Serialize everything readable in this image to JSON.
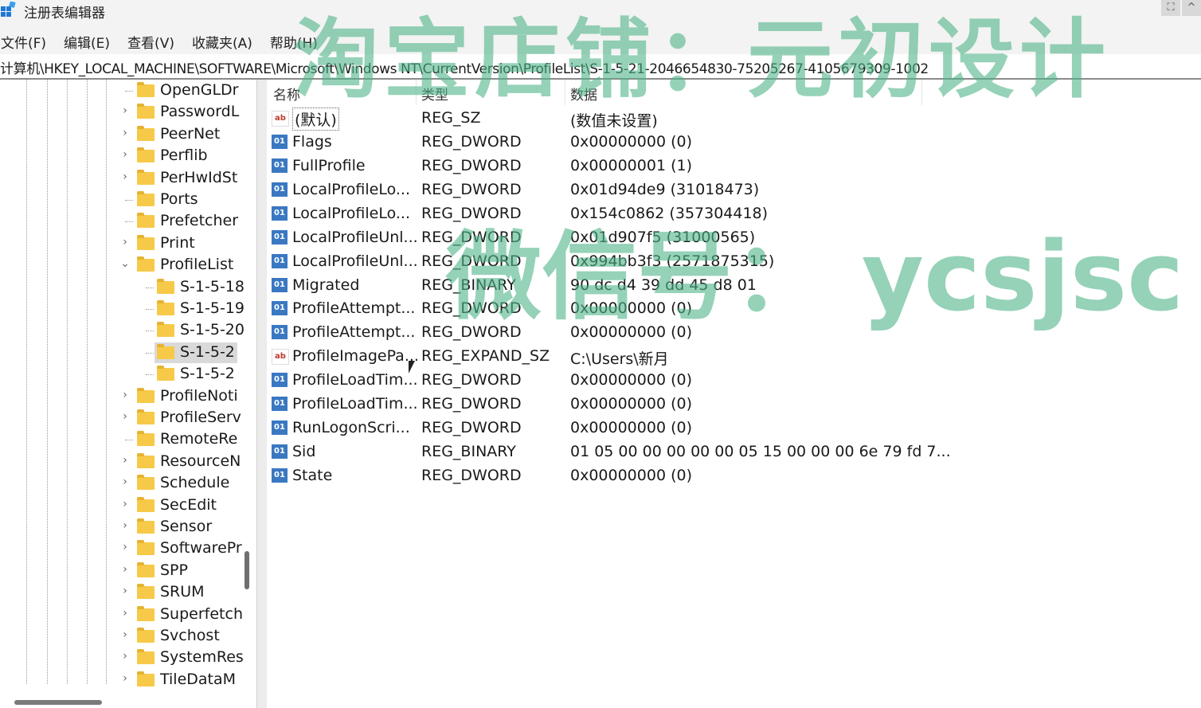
{
  "window": {
    "title": "注册表编辑器"
  },
  "menu": [
    "文件(F)",
    "编辑(E)",
    "查看(V)",
    "收藏夹(A)",
    "帮助(H)"
  ],
  "address": "计算机\\HKEY_LOCAL_MACHINE\\SOFTWARE\\Microsoft\\Windows NT\\CurrentVersion\\ProfileList\\S-1-5-21-2046654830-75205267-4105679309-1002",
  "tree": {
    "items": [
      {
        "label": "OpenGLDr",
        "expander": "none"
      },
      {
        "label": "PasswordL",
        "expander": "collapsed"
      },
      {
        "label": "PeerNet",
        "expander": "collapsed"
      },
      {
        "label": "Perflib",
        "expander": "collapsed"
      },
      {
        "label": "PerHwIdSt",
        "expander": "collapsed"
      },
      {
        "label": "Ports",
        "expander": "none"
      },
      {
        "label": "Prefetcher",
        "expander": "none"
      },
      {
        "label": "Print",
        "expander": "collapsed"
      },
      {
        "label": "ProfileList",
        "expander": "expanded"
      },
      {
        "label": "S-1-5-18",
        "expander": "child"
      },
      {
        "label": "S-1-5-19",
        "expander": "child"
      },
      {
        "label": "S-1-5-20",
        "expander": "child"
      },
      {
        "label": "S-1-5-2",
        "expander": "child",
        "selected": true
      },
      {
        "label": "S-1-5-2",
        "expander": "child"
      },
      {
        "label": "ProfileNoti",
        "expander": "collapsed"
      },
      {
        "label": "ProfileServ",
        "expander": "collapsed"
      },
      {
        "label": "RemoteRe",
        "expander": "none"
      },
      {
        "label": "ResourceN",
        "expander": "collapsed"
      },
      {
        "label": "Schedule",
        "expander": "collapsed"
      },
      {
        "label": "SecEdit",
        "expander": "collapsed"
      },
      {
        "label": "Sensor",
        "expander": "collapsed"
      },
      {
        "label": "SoftwarePr",
        "expander": "collapsed"
      },
      {
        "label": "SPP",
        "expander": "collapsed"
      },
      {
        "label": "SRUM",
        "expander": "collapsed"
      },
      {
        "label": "Superfetch",
        "expander": "collapsed"
      },
      {
        "label": "Svchost",
        "expander": "collapsed"
      },
      {
        "label": "SystemRes",
        "expander": "collapsed"
      },
      {
        "label": "TileDataM",
        "expander": "collapsed"
      }
    ]
  },
  "values": {
    "headers": {
      "name": "名称",
      "type": "类型",
      "data": "数据"
    },
    "rows": [
      {
        "icon": "string-value-icon",
        "name": "(默认)",
        "type": "REG_SZ",
        "data": "(数值未设置)"
      },
      {
        "icon": "binary-value-icon",
        "name": "Flags",
        "type": "REG_DWORD",
        "data": "0x00000000 (0)"
      },
      {
        "icon": "binary-value-icon",
        "name": "FullProfile",
        "type": "REG_DWORD",
        "data": "0x00000001 (1)"
      },
      {
        "icon": "binary-value-icon",
        "name": "LocalProfileLo...",
        "type": "REG_DWORD",
        "data": "0x01d94de9 (31018473)"
      },
      {
        "icon": "binary-value-icon",
        "name": "LocalProfileLo...",
        "type": "REG_DWORD",
        "data": "0x154c0862 (357304418)"
      },
      {
        "icon": "binary-value-icon",
        "name": "LocalProfileUnl...",
        "type": "REG_DWORD",
        "data": "0x01d907f5 (31000565)"
      },
      {
        "icon": "binary-value-icon",
        "name": "LocalProfileUnl...",
        "type": "REG_DWORD",
        "data": "0x994bb3f3 (2571875315)"
      },
      {
        "icon": "binary-value-icon",
        "name": "Migrated",
        "type": "REG_BINARY",
        "data": "90 dc d4 39 dd 45 d8 01"
      },
      {
        "icon": "binary-value-icon",
        "name": "ProfileAttempt...",
        "type": "REG_DWORD",
        "data": "0x00000000 (0)"
      },
      {
        "icon": "binary-value-icon",
        "name": "ProfileAttempt...",
        "type": "REG_DWORD",
        "data": "0x00000000 (0)"
      },
      {
        "icon": "string-value-icon",
        "name": "ProfileImagePa...",
        "type": "REG_EXPAND_SZ",
        "data": "C:\\Users\\新月"
      },
      {
        "icon": "binary-value-icon",
        "name": "ProfileLoadTim...",
        "type": "REG_DWORD",
        "data": "0x00000000 (0)"
      },
      {
        "icon": "binary-value-icon",
        "name": "ProfileLoadTim...",
        "type": "REG_DWORD",
        "data": "0x00000000 (0)"
      },
      {
        "icon": "binary-value-icon",
        "name": "RunLogonScri...",
        "type": "REG_DWORD",
        "data": "0x00000000 (0)"
      },
      {
        "icon": "binary-value-icon",
        "name": "Sid",
        "type": "REG_BINARY",
        "data": "01 05 00 00 00 00 00 05 15 00 00 00 6e 79 fd 7..."
      },
      {
        "icon": "binary-value-icon",
        "name": "State",
        "type": "REG_DWORD",
        "data": "0x00000000 (0)"
      }
    ]
  },
  "watermarks": {
    "shop": "淘宝店铺：元初设计",
    "wechat": "微信号： ycsjsc"
  },
  "colors": {
    "watermark": "#4fb58a",
    "folder": "#f7c948",
    "selection": "#d9d9d9",
    "binary_icon": "#3a78c2",
    "string_icon": "#c0392b"
  }
}
